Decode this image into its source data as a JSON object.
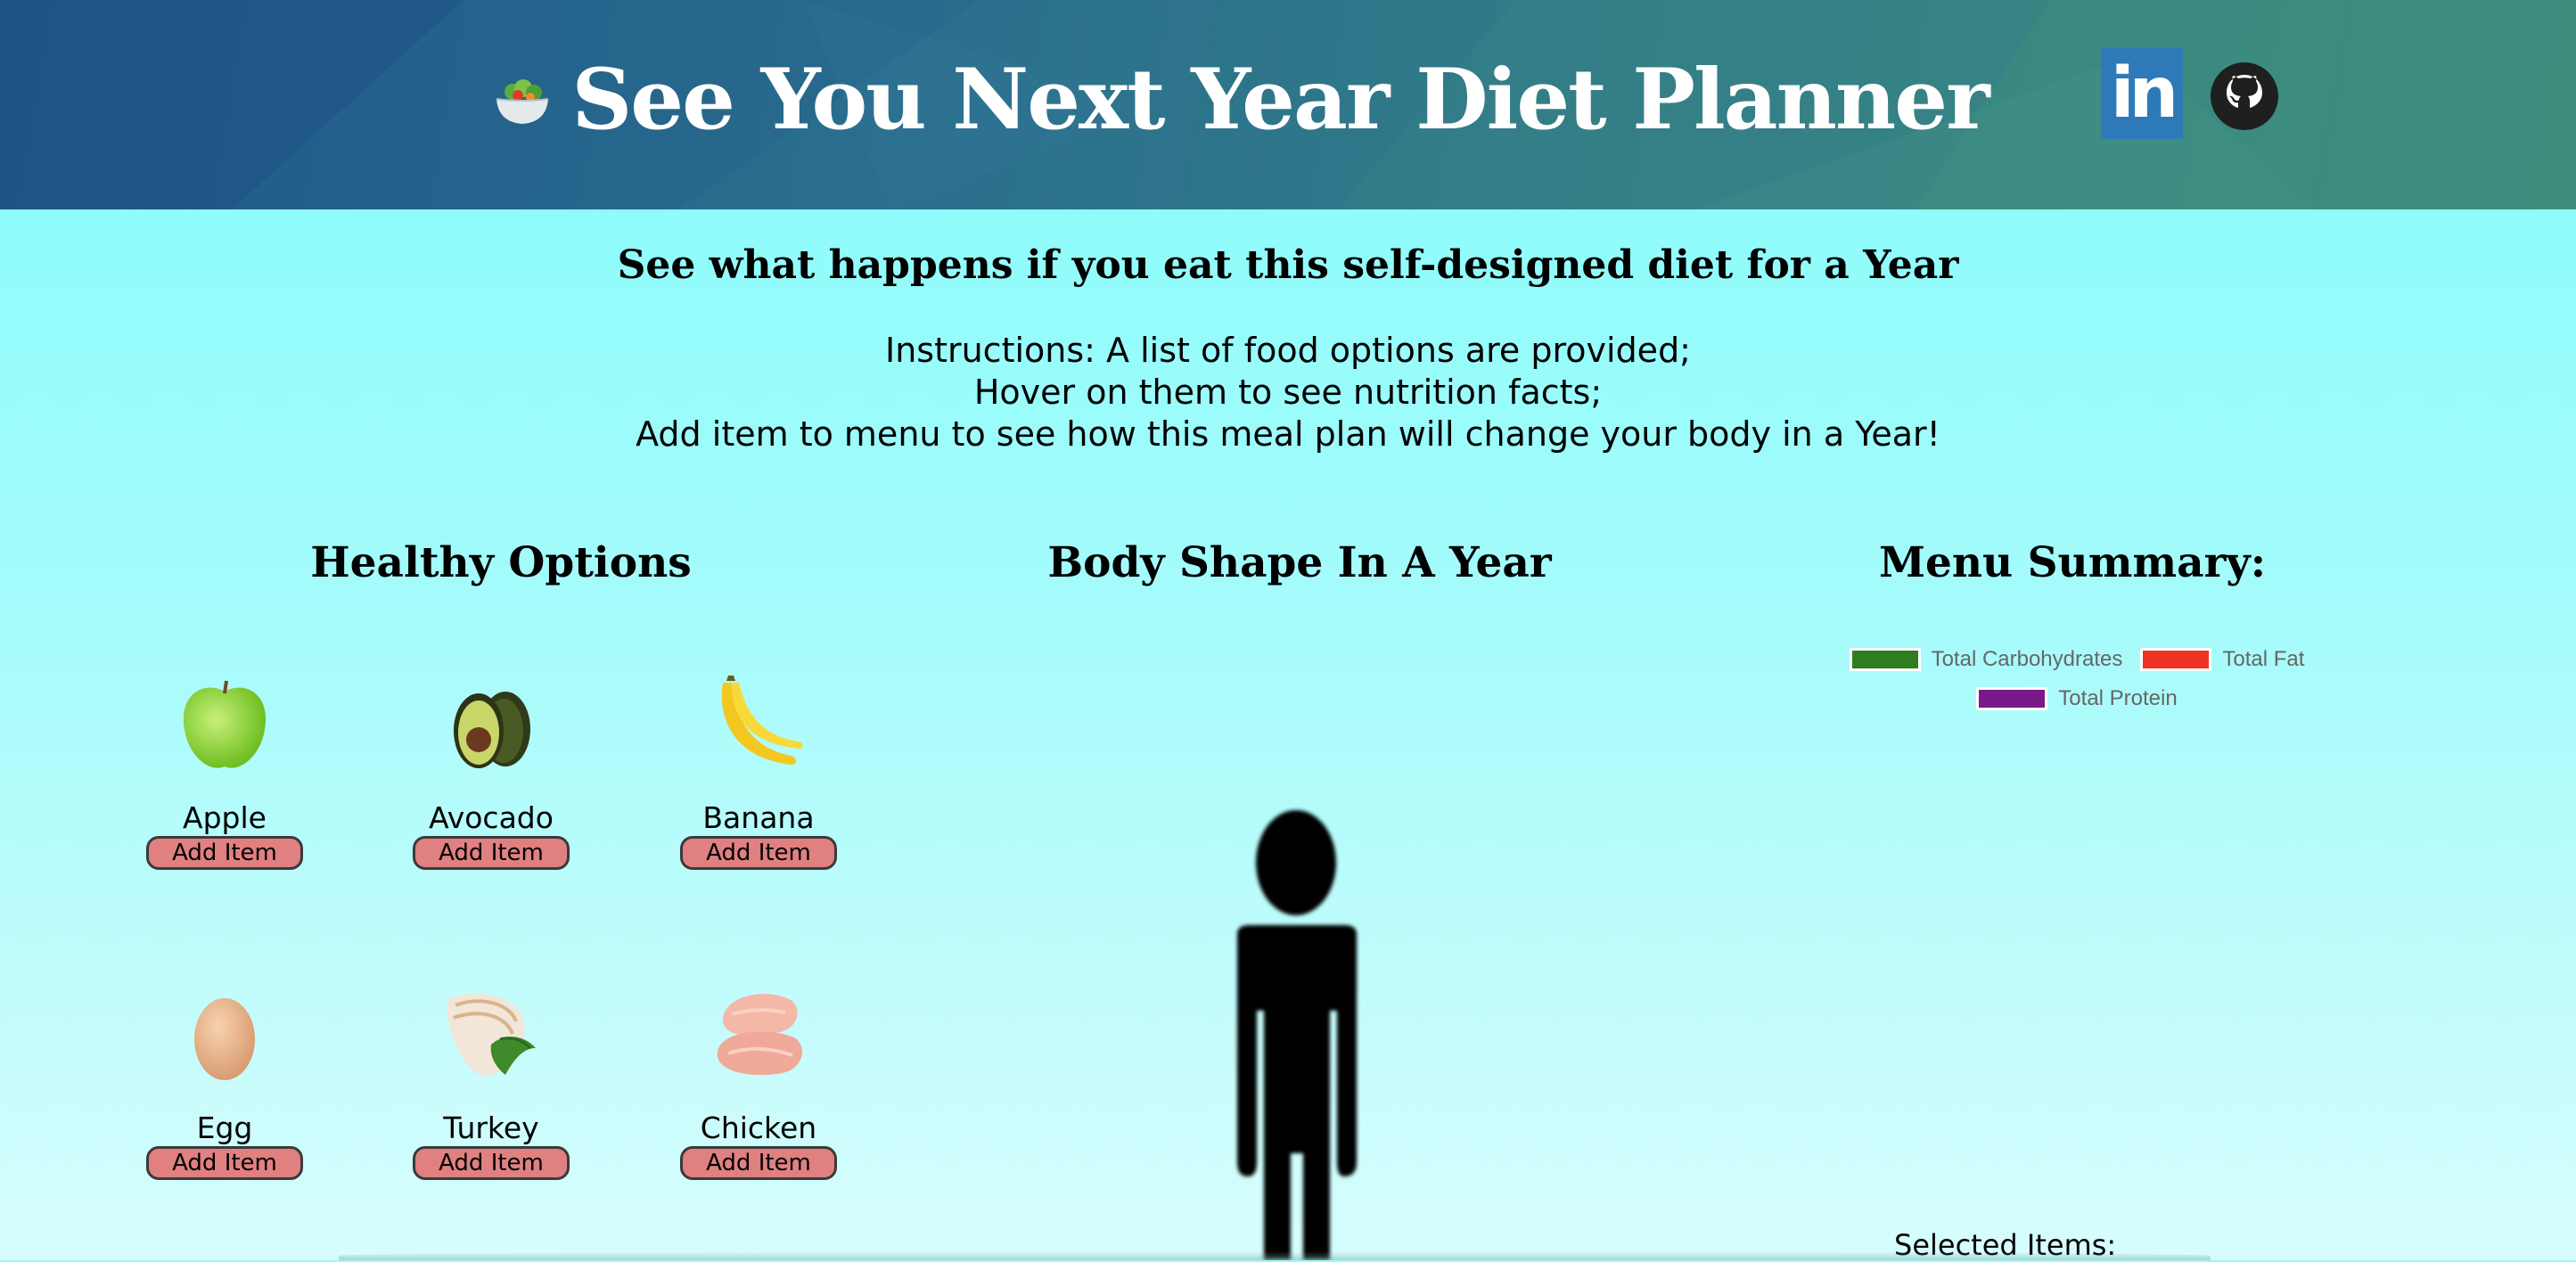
{
  "header": {
    "title": "See You Next Year Diet Planner",
    "logo_icon": "salad-bowl-icon",
    "social": [
      "linkedin-icon",
      "github-icon"
    ],
    "linkedin_text": "in"
  },
  "intro": {
    "subtitle": "See what happens if you eat this self-designed diet for a Year",
    "instructions": [
      "Instructions: A list of food options are provided;",
      "Hover on them to see nutrition facts;",
      "Add item to menu to see how this meal plan will change your body in a Year!"
    ]
  },
  "sections": {
    "healthy": "Healthy Options",
    "body": "Body Shape In A Year",
    "summary": "Menu Summary:"
  },
  "foods": [
    {
      "name": "Apple",
      "button": "Add Item",
      "icon": "apple-icon"
    },
    {
      "name": "Avocado",
      "button": "Add Item",
      "icon": "avocado-icon"
    },
    {
      "name": "Banana",
      "button": "Add Item",
      "icon": "banana-icon"
    },
    {
      "name": "Egg",
      "button": "Add Item",
      "icon": "egg-icon"
    },
    {
      "name": "Turkey",
      "button": "Add Item",
      "icon": "turkey-icon"
    },
    {
      "name": "Chicken",
      "button": "Add Item",
      "icon": "chicken-icon"
    }
  ],
  "legend": [
    {
      "label": "Total Carbohydrates",
      "color": "#2e7d1f"
    },
    {
      "label": "Total Fat",
      "color": "#ee3322"
    },
    {
      "label": "Total Protein",
      "color": "#7a1a8a"
    }
  ],
  "selected_items_label": "Selected Items:",
  "colors": {
    "page_background": "#8ffcfb",
    "banner": "#2a6f8e",
    "add_button": "#e08080"
  }
}
